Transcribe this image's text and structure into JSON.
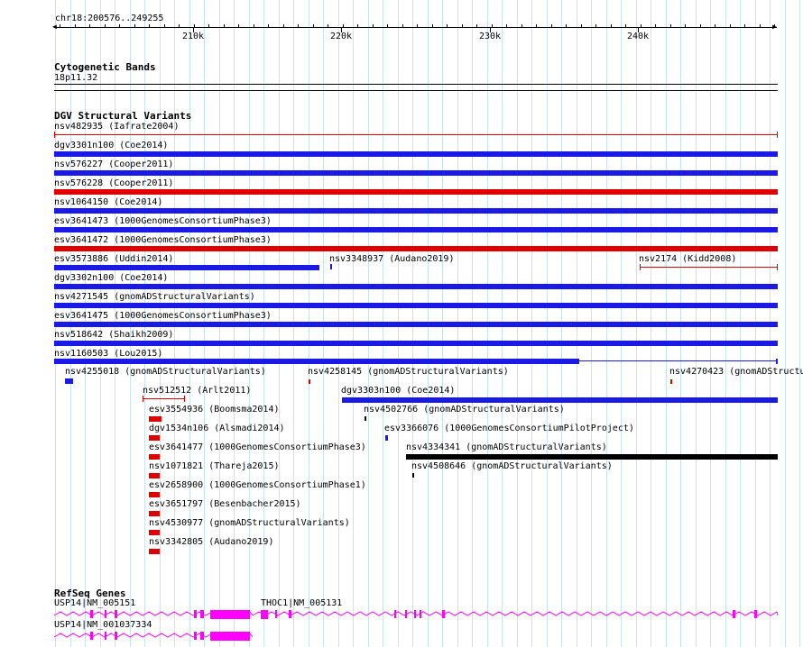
{
  "ruler": {
    "region": "chr18:200576..249255",
    "ticks": [
      "210k",
      "220k",
      "230k",
      "240k"
    ]
  },
  "tracks": {
    "cytoband": {
      "title": "Cytogenetic Bands",
      "band": "18p11.32"
    },
    "dgv": {
      "title": "DGV Structural Variants"
    },
    "refseq": {
      "title": "RefSeq Genes"
    }
  },
  "variants": [
    {
      "label": "nsv482935 (Iafrate2004)",
      "color": "#e00000",
      "style": "thin"
    },
    {
      "label": "dgv3301n100 (Coe2014)",
      "color": "#1a1ae6",
      "style": "thick"
    },
    {
      "label": "nsv576227 (Cooper2011)",
      "color": "#1a1ae6",
      "style": "thick"
    },
    {
      "label": "nsv576228 (Cooper2011)",
      "color": "#e00000",
      "style": "thick"
    },
    {
      "label": "nsv1064150 (Coe2014)",
      "color": "#1a1ae6",
      "style": "thick"
    },
    {
      "label": "esv3641473 (1000GenomesConsortiumPhase3)",
      "color": "#1a1ae6",
      "style": "thick"
    },
    {
      "label": "esv3641472 (1000GenomesConsortiumPhase3)",
      "color": "#e00000",
      "style": "thick"
    },
    {
      "label": "esv3573886 (Uddin2014)",
      "color": "#1a1ae6",
      "style": "thick"
    },
    {
      "label": "nsv3348937 (Audano2019)",
      "color": "#1a1ae6",
      "style": "tiny"
    },
    {
      "label": "nsv2174 (Kidd2008)",
      "color": "#e00000",
      "style": "thin"
    },
    {
      "label": "dgv3302n100 (Coe2014)",
      "color": "#1a1ae6",
      "style": "thick"
    },
    {
      "label": "nsv4271545 (gnomADStructuralVariants)",
      "color": "#1a1ae6",
      "style": "thick"
    },
    {
      "label": "esv3641475 (1000GenomesConsortiumPhase3)",
      "color": "#1a1ae6",
      "style": "thick"
    },
    {
      "label": "nsv518642 (Shaikh2009)",
      "color": "#1a1ae6",
      "style": "thick"
    },
    {
      "label": "nsv1160503 (Lou2015)",
      "color": "#1a1ae6",
      "style": "split"
    },
    {
      "label": "nsv4255018 (gnomADStructuralVariants)",
      "color": "#1a1ae6",
      "style": "tiny"
    },
    {
      "label": "nsv4258145 (gnomADStructuralVariants)",
      "color": "#e00000",
      "style": "tiny"
    },
    {
      "label": "nsv4270423 (gnomADStructu",
      "color": "#e00000",
      "style": "tiny"
    },
    {
      "label": "nsv512512 (Arlt2011)",
      "color": "#e00000",
      "style": "thin"
    },
    {
      "label": "dgv3303n100 (Coe2014)",
      "color": "#1a1ae6",
      "style": "thick"
    },
    {
      "label": "esv3554936 (Boomsma2014)",
      "color": "#e00000",
      "style": "small"
    },
    {
      "label": "nsv4502766 (gnomADStructuralVariants)",
      "color": "#000000",
      "style": "tiny"
    },
    {
      "label": "dgv1534n106 (Alsmadi2014)",
      "color": "#e00000",
      "style": "small"
    },
    {
      "label": "esv3366076 (1000GenomesConsortiumPilotProject)",
      "color": "#1a1ae6",
      "style": "tiny"
    },
    {
      "label": "esv3641477 (1000GenomesConsortiumPhase3)",
      "color": "#e00000",
      "style": "small"
    },
    {
      "label": "nsv4334341 (gnomADStructuralVariants)",
      "color": "#000000",
      "style": "thick"
    },
    {
      "label": "nsv1071821 (Thareja2015)",
      "color": "#e00000",
      "style": "small"
    },
    {
      "label": "nsv4508646 (gnomADStructuralVariants)",
      "color": "#000000",
      "style": "tiny"
    },
    {
      "label": "esv2658900 (1000GenomesConsortiumPhase1)",
      "color": "#e00000",
      "style": "small"
    },
    {
      "label": "esv3651797 (Besenbacher2015)",
      "color": "#e00000",
      "style": "small"
    },
    {
      "label": "nsv4530977 (gnomADStructuralVariants)",
      "color": "#e00000",
      "style": "small"
    },
    {
      "label": "nsv3342805 (Audano2019)",
      "color": "#e00000",
      "style": "small"
    }
  ],
  "genes": [
    {
      "label": "USP14|NM_005151",
      "color": "#ff00ff"
    },
    {
      "label": "THOC1|NM_005131",
      "color": "#ff00ff"
    },
    {
      "label": "USP14|NM_001037334",
      "color": "#ff00ff"
    }
  ]
}
